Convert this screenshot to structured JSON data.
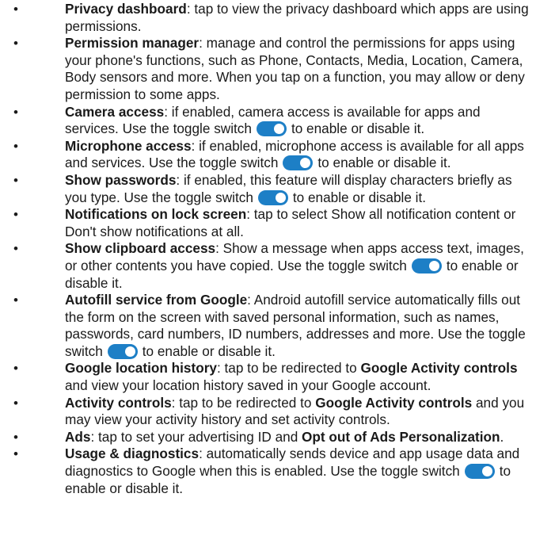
{
  "items": [
    {
      "term": "Privacy dashboard",
      "desc": ": tap to view the privacy dashboard which apps are using permissions."
    },
    {
      "term": "Permission manager",
      "desc": ": manage and control the permissions for apps using your phone's functions, such as Phone, Contacts, Media, Location, Camera, Body sensors and more. When you tap on a function, you may allow or deny permission to some apps."
    },
    {
      "term": "Camera access",
      "desc": ": if enabled, camera access is available for apps and services. Use the toggle switch",
      "after": "to enable or disable it."
    },
    {
      "term": "Microphone access",
      "desc": ": if enabled, microphone access is available for all apps and services. Use the toggle switch",
      "after": "to enable or disable it."
    },
    {
      "term": "Show passwords",
      "desc": ": if enabled, this feature will display characters briefly as you type. Use the toggle switch",
      "after": "to enable or disable it."
    },
    {
      "term": "Notifications on lock screen",
      "desc": ": tap to select Show all notification content or Don't show notifications at all."
    },
    {
      "term": "Show clipboard access",
      "desc": ": Show a message when apps access text, images, or other contents you have copied. Use the toggle switch",
      "after": "to enable or disable it."
    },
    {
      "term": "Autofill service from Google",
      "desc": ": Android autofill service automatically fills out the form on the screen with saved personal information, such as names, passwords, card numbers, ID numbers, addresses and more. Use the toggle switch",
      "after": "to enable or disable it."
    },
    {
      "term": "Google location history",
      "desc": ": tap to be redirected to",
      "emph": "Google Activity controls",
      "after": "and view your location history saved in your Google account."
    },
    {
      "term": "Activity controls",
      "desc": ": tap to be redirected to",
      "emph": "Google Activity controls",
      "after": "and you may view your activity history and set activity controls."
    },
    {
      "term": "Ads",
      "desc": ": tap to set your advertising ID and",
      "emph": "Opt out of Ads Personalization",
      "after": "."
    },
    {
      "term": "Usage & diagnostics",
      "desc": ": automatically sends device and app usage data and diagnostics to Google when this is enabled. Use the toggle switch",
      "after": "to enable or disable it."
    }
  ],
  "toggle": {
    "state": "on",
    "track_color": "#1d7fc6",
    "knob_color": "#ffffff"
  }
}
